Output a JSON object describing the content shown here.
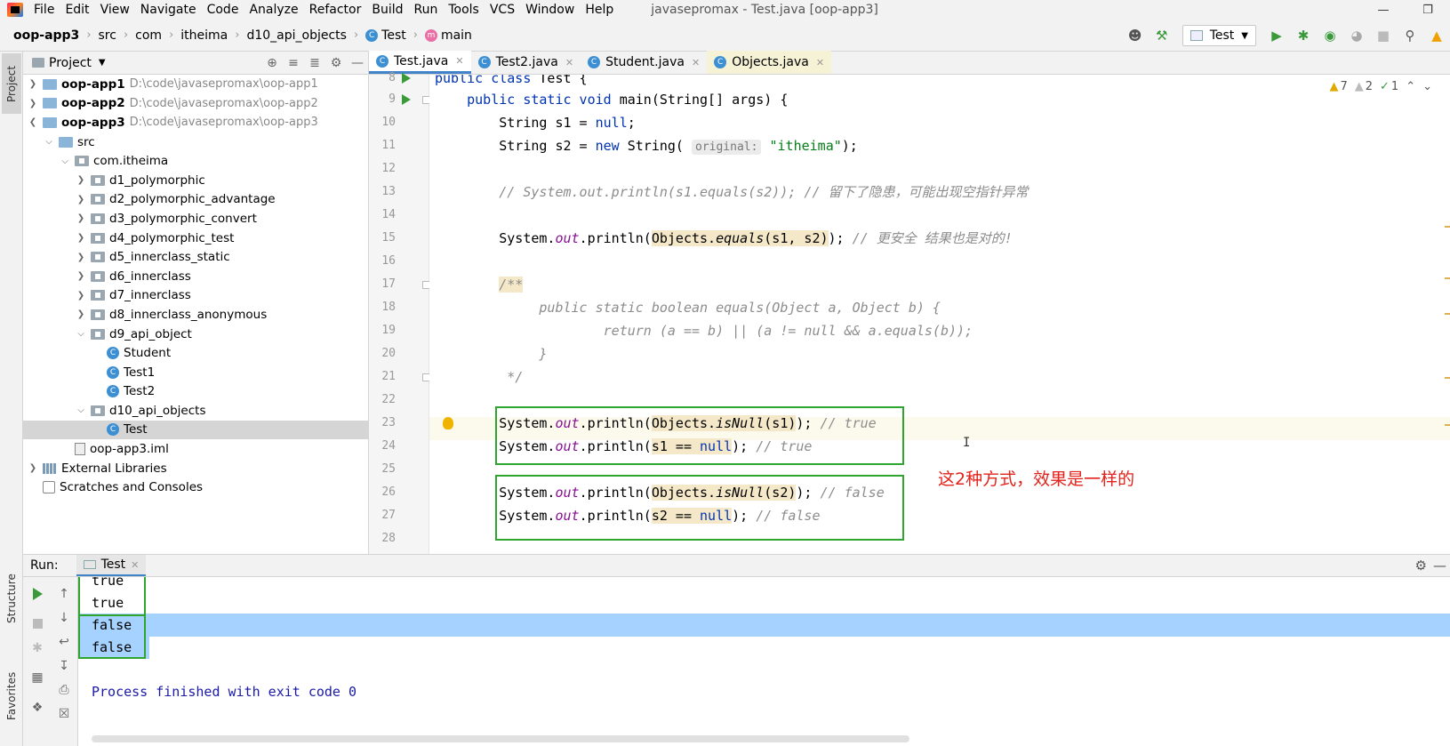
{
  "menu": {
    "items": [
      "File",
      "Edit",
      "View",
      "Navigate",
      "Code",
      "Analyze",
      "Refactor",
      "Build",
      "Run",
      "Tools",
      "VCS",
      "Window",
      "Help"
    ],
    "window_title": "javasepromax - Test.java [oop-app3]"
  },
  "breadcrumb": {
    "items": [
      "oop-app3",
      "src",
      "com",
      "itheima",
      "d10_api_objects",
      "Test",
      "main"
    ]
  },
  "toolbar": {
    "run_config": "Test"
  },
  "stripes": {
    "project": "Project",
    "structure": "Structure",
    "favorites": "Favorites"
  },
  "project_panel": {
    "title": "Project",
    "tree": [
      {
        "label": "oop-app1",
        "path": "D:\\code\\javasepromax\\oop-app1"
      },
      {
        "label": "oop-app2",
        "path": "D:\\code\\javasepromax\\oop-app2"
      },
      {
        "label": "oop-app3",
        "path": "D:\\code\\javasepromax\\oop-app3"
      },
      {
        "label": "src"
      },
      {
        "label": "com.itheima"
      },
      {
        "label": "d1_polymorphic"
      },
      {
        "label": "d2_polymorphic_advantage"
      },
      {
        "label": "d3_polymorphic_convert"
      },
      {
        "label": "d4_polymorphic_test"
      },
      {
        "label": "d5_innerclass_static"
      },
      {
        "label": "d6_innerclass"
      },
      {
        "label": "d7_innerclass"
      },
      {
        "label": "d8_innerclass_anonymous"
      },
      {
        "label": "d9_api_object"
      },
      {
        "label": "Student"
      },
      {
        "label": "Test1"
      },
      {
        "label": "Test2"
      },
      {
        "label": "d10_api_objects"
      },
      {
        "label": "Test"
      },
      {
        "label": "oop-app3.iml"
      },
      {
        "label": "External Libraries"
      },
      {
        "label": "Scratches and Consoles"
      }
    ]
  },
  "editor": {
    "tabs": [
      "Test.java",
      "Test2.java",
      "Student.java",
      "Objects.java"
    ],
    "line_numbers": [
      "8",
      "9",
      "10",
      "11",
      "12",
      "13",
      "14",
      "15",
      "16",
      "17",
      "18",
      "19",
      "20",
      "21",
      "22",
      "23",
      "24",
      "25",
      "26",
      "27",
      "28"
    ],
    "inspections": {
      "warnings": "7",
      "weak_warnings": "2",
      "ok": "1"
    },
    "hint_original": "original:",
    "annotation": "这2种方式，效果是一样的"
  },
  "run_panel": {
    "label": "Run:",
    "tab": "Test",
    "output": [
      "true",
      "true",
      "false",
      "false",
      "",
      "Process finished with exit code 0"
    ]
  },
  "colors": {
    "highlight_box": "#2ea52e",
    "annotation_text": "#e3221b",
    "selection": "#a6d2ff"
  }
}
